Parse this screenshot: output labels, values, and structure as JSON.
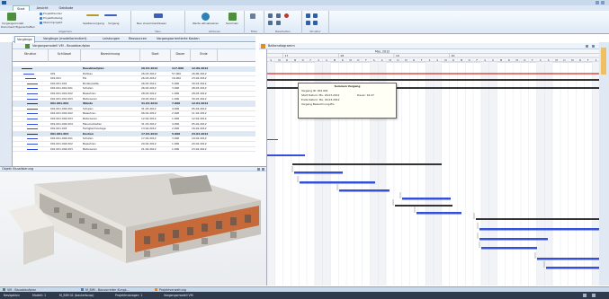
{
  "ribbon": {
    "tabs": [
      "Start",
      "Ansicht",
      "Gebäude"
    ],
    "active_tab": "Start",
    "groups": [
      "Allgemein",
      "Neu",
      "Aktionen",
      "Filter",
      "Bearbeiten",
      "Struktur"
    ],
    "labels": {
      "vorgangsmodell": "Vorgangsmodell",
      "dokument_eigenschaften": "Dokument Eigenschaften",
      "projektfenster": "Projektfenster",
      "projektkatalog": "Projektkatalog",
      "stammprojekt": "Stammprojekt",
      "spaltenvorgang": "Spaltenvorgang",
      "vorgang": "Vorgang",
      "neu_zusammenfassen": "Neu zusammenfassen",
      "werte_aktualisieren": "Werte aktualisieren",
      "sammeln": "Sammeln"
    }
  },
  "subtabs": [
    "Vorgänge",
    "Vorgänge (modellorientiert)",
    "Leistungen",
    "Ressourcen",
    "Vorgangsorientierte Kosten"
  ],
  "active_subtab": "Vorgänge",
  "grid": {
    "title": "Vorgangsmodell VM - Bauabkaufplan",
    "columns": [
      "Struktur",
      "Schlüssel",
      "Bezeichnung",
      "Start",
      "Dauer",
      "Ende"
    ],
    "rows": [
      {
        "schl": "",
        "bez": "Bauablaufplan",
        "start": "26.03.2012",
        "dauer": "117.000",
        "ende": "12.09.2012",
        "sum": true
      },
      {
        "schl": "001",
        "bez": "Rohbau",
        "start": "26.03.2012",
        "dauer": "57.000",
        "ende": "26.06.2012",
        "sum": false
      },
      {
        "schl": "001.001",
        "bez": "EG",
        "start": "26.03.2012",
        "dauer": "16.000",
        "ende": "23.04.2012",
        "sum": false
      },
      {
        "schl": "001.001.001",
        "bez": "Bodenplatte",
        "start": "26.03.2012",
        "dauer": "5.000",
        "ende": "30.03.2012",
        "sum": false
      },
      {
        "schl": "001.001.001.001",
        "bez": "Schalen",
        "start": "26.03.2012",
        "dauer": "3.000",
        "ende": "28.03.2012",
        "sum": false
      },
      {
        "schl": "001.001.001.002",
        "bez": "Bewehren",
        "start": "28.03.2012",
        "dauer": "1.000",
        "ende": "28.03.2012",
        "sum": false
      },
      {
        "schl": "001.001.001.003",
        "bez": "Betonieren",
        "start": "29.03.2012",
        "dauer": "1.000",
        "ende": "30.03.2012",
        "sum": false
      },
      {
        "schl": "001.001.002",
        "bez": "Wände",
        "start": "31.03.2012",
        "dauer": "7.000",
        "ende": "12.04.2012",
        "sum": true
      },
      {
        "schl": "001.001.002.001",
        "bez": "Schalen",
        "start": "31.03.2012",
        "dauer": "4.000",
        "ende": "05.04.2012",
        "sum": false
      },
      {
        "schl": "001.001.002.002",
        "bez": "Bewehren",
        "start": "06.04.2012",
        "dauer": "2.000",
        "ende": "11.04.2012",
        "sum": false
      },
      {
        "schl": "001.001.002.003",
        "bez": "Betonieren",
        "start": "12.04.2012",
        "dauer": "1.000",
        "ende": "12.04.2012",
        "sum": false
      },
      {
        "schl": "001.001.002.004",
        "bez": "Mauerarbeiten",
        "start": "31.03.2012",
        "dauer": "4.000",
        "ende": "05.04.2012",
        "sum": false
      },
      {
        "schl": "001.001.003",
        "bez": "Fertigteilmontage",
        "start": "13.04.2012",
        "dauer": "2.000",
        "ende": "16.04.2012",
        "sum": false
      },
      {
        "schl": "001.001.004",
        "bez": "Decken",
        "start": "17.04.2012",
        "dauer": "5.000",
        "ende": "23.04.2012",
        "sum": true
      },
      {
        "schl": "001.001.004.001",
        "bez": "Schalen",
        "start": "17.04.2012",
        "dauer": "3.000",
        "ende": "19.04.2012",
        "sum": false
      },
      {
        "schl": "001.001.004.002",
        "bez": "Bewehren",
        "start": "20.04.2012",
        "dauer": "1.000",
        "ende": "20.04.2012",
        "sum": false
      },
      {
        "schl": "001.001.004.003",
        "bez": "Betonieren",
        "start": "21.04.2012",
        "dauer": "1.000",
        "ende": "23.04.2012",
        "sum": false
      }
    ]
  },
  "model_view": {
    "title": "Objekt Visualisierung"
  },
  "gantt": {
    "title": "Balkendiagramm",
    "month": "Mai, 2012",
    "weeks": [
      "17",
      "18",
      "19",
      "20"
    ],
    "day_letters": [
      "S",
      "M",
      "D",
      "M",
      "D",
      "F",
      "S",
      "S",
      "M",
      "D",
      "M",
      "D",
      "F",
      "S",
      "S",
      "M",
      "D",
      "M",
      "D",
      "F",
      "S",
      "S",
      "M",
      "D",
      "M",
      "D",
      "F",
      "S",
      "S",
      "M",
      "D",
      "M",
      "D",
      "F",
      "S",
      "S",
      "M",
      "D",
      "M",
      "D",
      "F",
      "S"
    ]
  },
  "tooltip": {
    "title": "Summen Vorgang",
    "line1": "Vorgang ID: 001.001",
    "line2": "Start Datum: Mo, 26.03.2012",
    "line2b": "Dauer: 16.47",
    "line3": "Ende Datum: Mo, 04.03.2012",
    "line4": "Vorgang Bezeichnung:EG"
  },
  "taskbar": [
    "VM - Bauablaufplan",
    "M_BIM - Bauvorreiter Kungs...",
    "Projektverwaltung"
  ],
  "status": {
    "navigation": "Navigation",
    "model": "Modell: 1",
    "file": "M_BIM 01 (bauteilscop)",
    "project": "Projektmanager: 1",
    "vm": "Vorgangsmodell VM"
  },
  "colors": {
    "accent": "#1e5ca6",
    "bar_blue": "#3550d8",
    "bar_black": "#333333",
    "red_line": "#e0281e"
  }
}
